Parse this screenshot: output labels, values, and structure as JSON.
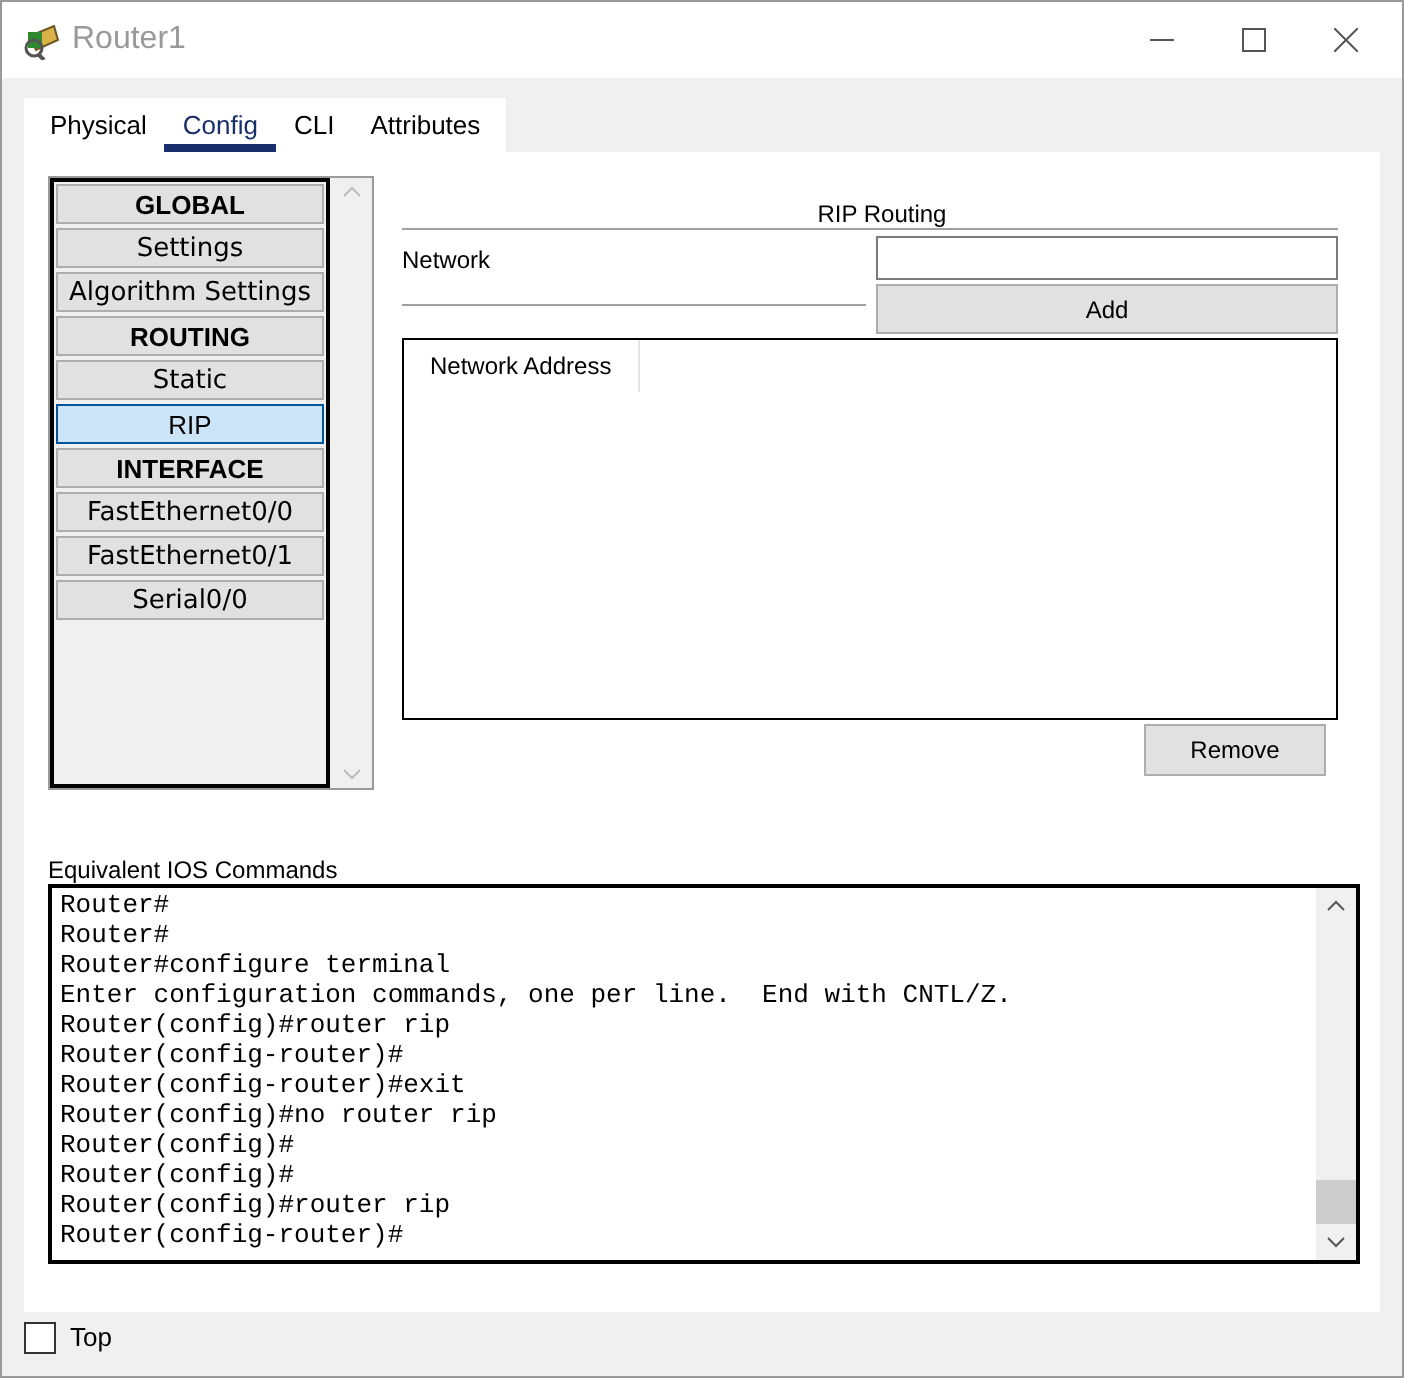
{
  "window": {
    "title": "Router1"
  },
  "tabs": [
    {
      "label": "Physical",
      "selected": false
    },
    {
      "label": "Config",
      "selected": true
    },
    {
      "label": "CLI",
      "selected": false
    },
    {
      "label": "Attributes",
      "selected": false
    }
  ],
  "sidebar": {
    "items": [
      {
        "label": "GLOBAL",
        "kind": "header",
        "selected": false
      },
      {
        "label": "Settings",
        "kind": "item",
        "selected": false
      },
      {
        "label": "Algorithm Settings",
        "kind": "item",
        "selected": false
      },
      {
        "label": "ROUTING",
        "kind": "header",
        "selected": false
      },
      {
        "label": "Static",
        "kind": "item",
        "selected": false
      },
      {
        "label": "RIP",
        "kind": "item",
        "selected": true
      },
      {
        "label": "INTERFACE",
        "kind": "header",
        "selected": false
      },
      {
        "label": "FastEthernet0/0",
        "kind": "item",
        "selected": false
      },
      {
        "label": "FastEthernet0/1",
        "kind": "item",
        "selected": false
      },
      {
        "label": "Serial0/0",
        "kind": "item",
        "selected": false
      }
    ]
  },
  "rip": {
    "title": "RIP Routing",
    "network_label": "Network",
    "add_button": "Add",
    "table": {
      "columns": [
        "Network Address"
      ]
    },
    "remove_button": "Remove"
  },
  "ios": {
    "label": "Equivalent IOS Commands",
    "lines": [
      "Router#",
      "Router#",
      "Router#configure terminal",
      "Enter configuration commands, one per line.  End with CNTL/Z.",
      "Router(config)#router rip",
      "Router(config-router)#",
      "Router(config-router)#exit",
      "Router(config)#no router rip",
      "Router(config)#",
      "Router(config)#",
      "Router(config)#router rip",
      "Router(config-router)#"
    ]
  },
  "top_checkbox": {
    "label": "Top",
    "checked": false
  }
}
